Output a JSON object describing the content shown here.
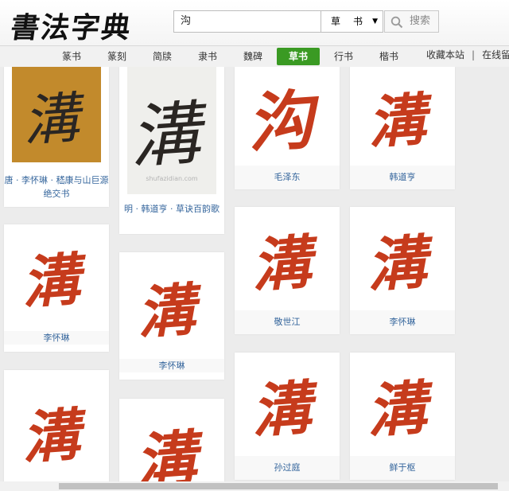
{
  "logo": "書法字典",
  "search": {
    "value": "沟",
    "script_value": "草书",
    "button_label": "搜索"
  },
  "nav": {
    "tabs": [
      "篆书",
      "篆刻",
      "简牍",
      "隶书",
      "魏碑",
      "草书",
      "行书",
      "楷书"
    ],
    "active_tab": "草书",
    "links": [
      "收藏本站",
      "在线留"
    ]
  },
  "results": [
    {
      "id": "r1",
      "glyph": "溝",
      "caption": "唐 · 李怀琳 · 嵇康与山巨源绝交书"
    },
    {
      "id": "r2",
      "glyph": "溝",
      "caption": "明 · 韩道亨 · 草诀百韵歌",
      "watermark": "shufazidian.com"
    },
    {
      "id": "r3",
      "glyph": "沟",
      "caption": "毛泽东"
    },
    {
      "id": "r4",
      "glyph": "溝",
      "caption": "韩道亨"
    },
    {
      "id": "r5",
      "glyph": "溝",
      "caption": "李怀琳"
    },
    {
      "id": "r6",
      "glyph": "溝",
      "caption": "李怀琳"
    },
    {
      "id": "r7",
      "glyph": "溝",
      "caption": "敬世江"
    },
    {
      "id": "r8",
      "glyph": "溝",
      "caption": "李怀琳"
    },
    {
      "id": "r9",
      "glyph": "溝",
      "caption": ""
    },
    {
      "id": "r10",
      "glyph": "溝",
      "caption": ""
    },
    {
      "id": "r11",
      "glyph": "溝",
      "caption": "孙过庭"
    },
    {
      "id": "r12",
      "glyph": "溝",
      "caption": "鲜于枢"
    }
  ],
  "colors": {
    "accent": "#3a9a23",
    "glyph_red": "#c63b1c",
    "caption_blue": "#34659c"
  }
}
